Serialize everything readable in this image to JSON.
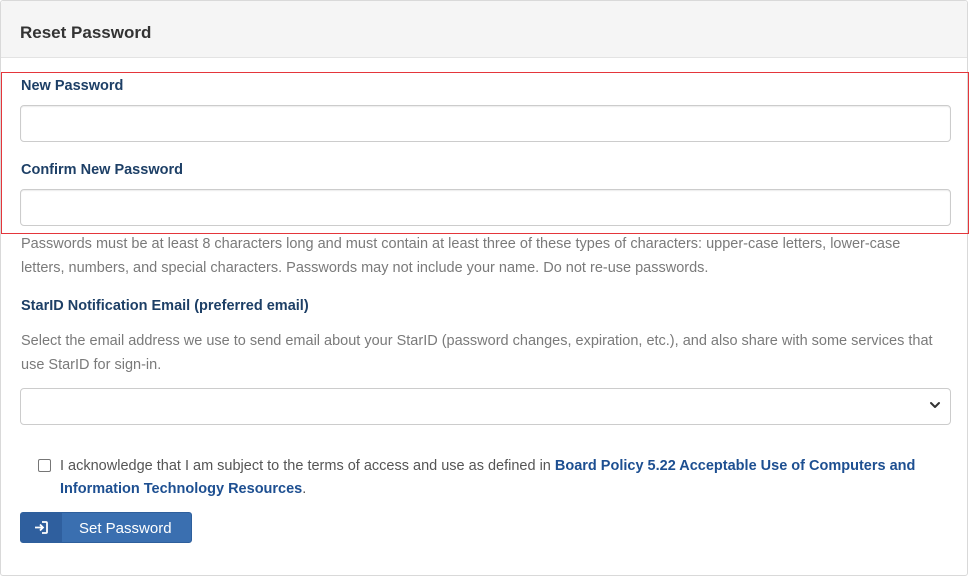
{
  "panel": {
    "title": "Reset Password"
  },
  "form": {
    "new_password_label": "New Password",
    "new_password_value": "",
    "confirm_password_label": "Confirm New Password",
    "confirm_password_value": "",
    "password_help": "Passwords must be at least 8 characters long and must contain at least three of these types of characters: upper-case letters, lower-case letters, numbers, and special characters. Passwords may not include your name. Do not re-use passwords.",
    "email_label": "StarID Notification Email (preferred email)",
    "email_help": "Select the email address we use to send email about your StarID (password changes, expiration, etc.), and also share with some services that use StarID for sign-in.",
    "email_selected": "",
    "acknowledge_text": "I acknowledge that I am subject to the terms of access and use as defined in ",
    "acknowledge_link": "Board Policy 5.22 Acceptable Use of Computers and Information Technology Resources",
    "acknowledge_suffix": ".",
    "acknowledge_checked": false,
    "submit_label": "Set Password",
    "submit_icon": "sign-in-icon"
  },
  "colors": {
    "highlight_border": "#e4363b",
    "label_color": "#1d3f66",
    "button_bg": "#3a6fb0",
    "link_color": "#1d4f91"
  }
}
